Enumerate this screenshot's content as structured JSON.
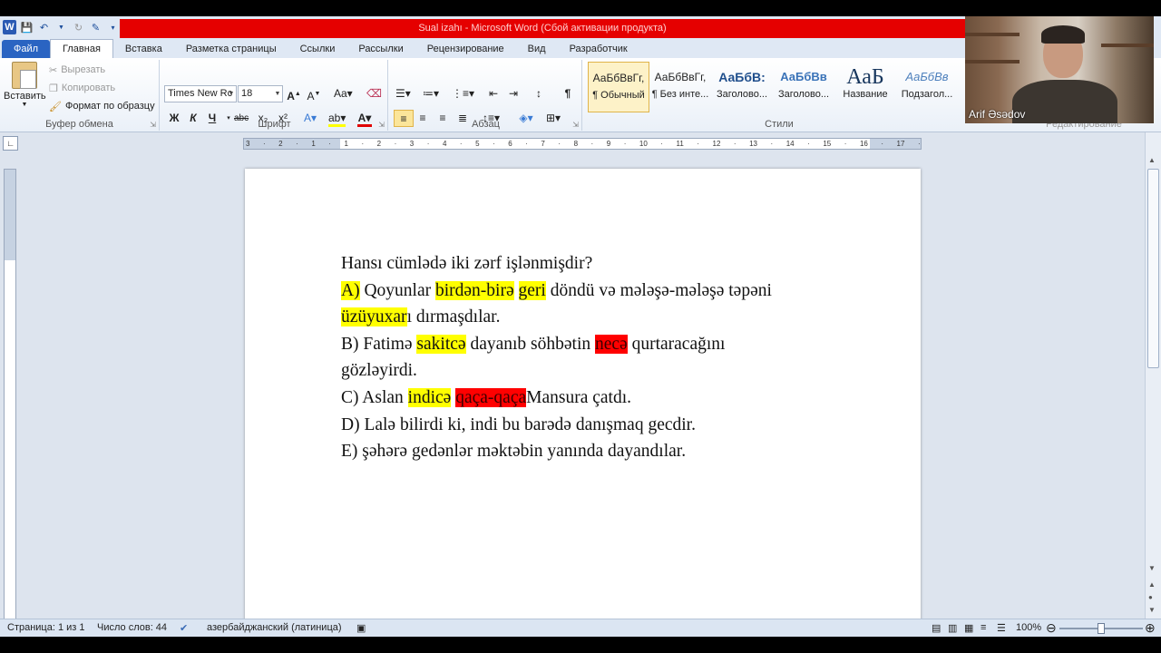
{
  "window": {
    "title": "Sual izahı  -  Microsoft Word (Сбой активации продукта)"
  },
  "tabs": [
    "Файл",
    "Главная",
    "Вставка",
    "Разметка страницы",
    "Ссылки",
    "Рассылки",
    "Рецензирование",
    "Вид",
    "Разработчик"
  ],
  "clipboard": {
    "paste": "Вставить",
    "cut": "Вырезать",
    "copy": "Копировать",
    "format_painter": "Формат по образцу",
    "label": "Буфер обмена"
  },
  "font": {
    "name": "Times New Rc",
    "size": "18",
    "label": "Шрифт",
    "bold": "Ж",
    "italic": "К",
    "underline": "Ч"
  },
  "paragraph": {
    "label": "Абзац"
  },
  "styles": {
    "label": "Стили",
    "items": [
      {
        "sample": "АаБбВвГг,",
        "name": "¶ Обычный"
      },
      {
        "sample": "АаБбВвГг,",
        "name": "¶ Без инте..."
      },
      {
        "sample": "АаБбВ:",
        "name": "Заголово..."
      },
      {
        "sample": "АаБбВв",
        "name": "Заголово..."
      },
      {
        "sample": "АаБ",
        "name": "Название"
      },
      {
        "sample": "АаБбВв",
        "name": "Подзагол..."
      }
    ]
  },
  "editing": {
    "label": "Редактирование"
  },
  "webcam": {
    "name": "Arif Əsədov"
  },
  "document": {
    "question": "Hansı cümlədə iki zərf işlənmişdir?",
    "lines": [
      [
        {
          "t": "A)",
          "h": "y"
        },
        {
          "t": " Qoyunlar "
        },
        {
          "t": "birdən-birə",
          "h": "y"
        },
        {
          "t": " "
        },
        {
          "t": "geri",
          "h": "y"
        },
        {
          "t": " döndü və mələşə-mələşə təpəni"
        }
      ],
      [
        {
          "t": "üzüyuxar",
          "h": "y"
        },
        {
          "t": "ı dırmaşdılar."
        }
      ],
      [
        {
          "t": "B) Fatimə "
        },
        {
          "t": "sakitcə",
          "h": "y"
        },
        {
          "t": " dayanıb söhbətin "
        },
        {
          "t": "necə",
          "h": "r"
        },
        {
          "t": " qurtaracağını"
        }
      ],
      [
        {
          "t": "gözləyirdi."
        }
      ],
      [
        {
          "t": "C) Aslan "
        },
        {
          "t": "indicə",
          "h": "y"
        },
        {
          "t": " "
        },
        {
          "t": "qaça-qaça",
          "h": "r"
        },
        {
          "t": "Mansura çatdı."
        }
      ],
      [
        {
          "t": "D) Lalə bilirdi ki, indi bu barədə danışmaq gecdir."
        }
      ],
      [
        {
          "t": "E) şəhərə gedənlər məktəbin yanında dayandılar."
        }
      ]
    ]
  },
  "statusbar": {
    "page": "Страница: 1 из 1",
    "words": "Число слов: 44",
    "language": "азербайджанский (латиница)",
    "zoom": "100%"
  },
  "ruler": {
    "ticks": [
      "3",
      "·",
      "2",
      "·",
      "1",
      "·",
      "1",
      "·",
      "2",
      "·",
      "3",
      "·",
      "4",
      "·",
      "5",
      "·",
      "6",
      "·",
      "7",
      "·",
      "8",
      "·",
      "9",
      "·",
      "10",
      "·",
      "11",
      "·",
      "12",
      "·",
      "13",
      "·",
      "14",
      "·",
      "15",
      "·",
      "16",
      "·",
      "17",
      "·"
    ]
  },
  "colors": {
    "title_bg": "#e50000",
    "file_tab": "#2a64c2",
    "highlight_yellow": "#ffff00",
    "highlight_red": "#ff0000"
  }
}
